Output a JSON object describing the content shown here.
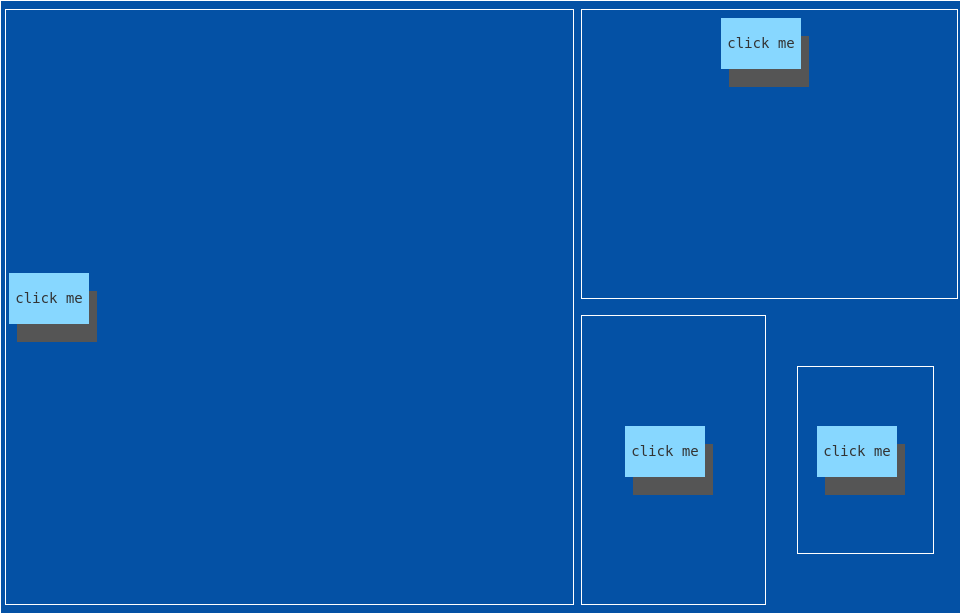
{
  "buttons": {
    "left_panel_button": "click me",
    "top_right_panel_button": "click me",
    "bottom_middle_panel_button": "click me",
    "bottom_right_panel_button": "click me"
  },
  "colors": {
    "background": "#0451a5",
    "border": "#ffffff",
    "button": "#87d7ff",
    "button_shadow": "#555555",
    "button_text": "#333333"
  }
}
